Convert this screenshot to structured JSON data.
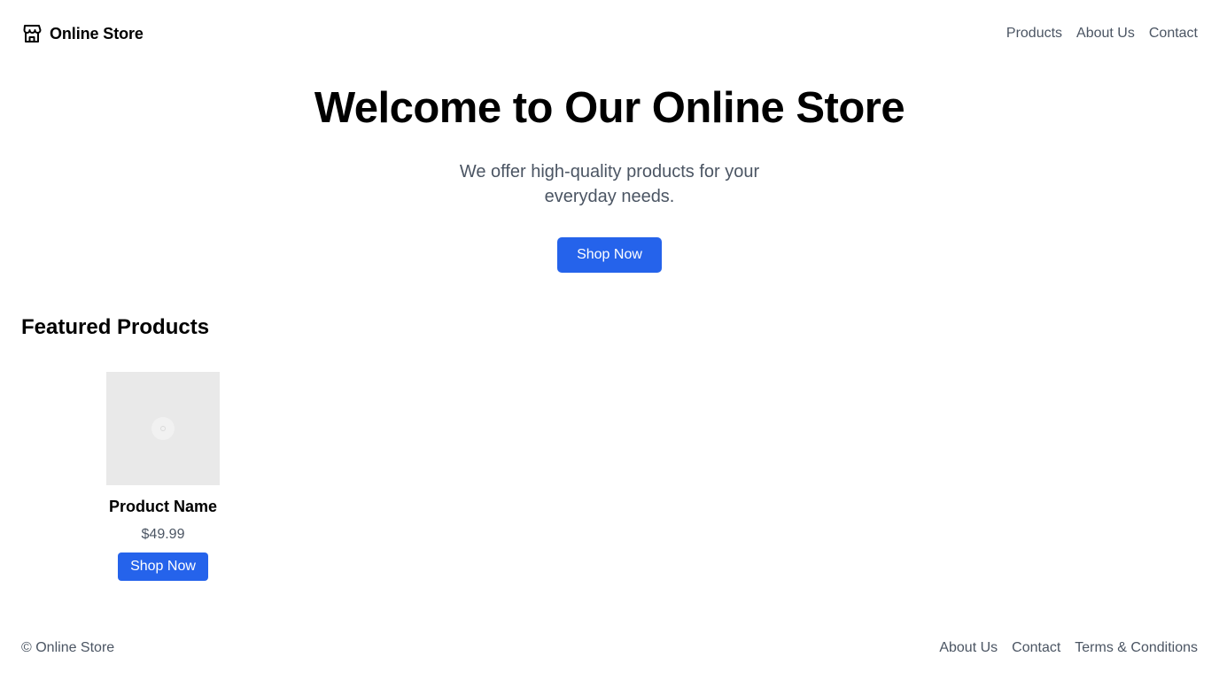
{
  "header": {
    "brand_name": "Online Store",
    "brand_icon": "store-icon",
    "nav": [
      "Products",
      "About Us",
      "Contact"
    ]
  },
  "hero": {
    "title": "Welcome to Our Online Store",
    "subtitle": "We offer high-quality products for your everyday needs.",
    "cta_label": "Shop Now"
  },
  "featured": {
    "title": "Featured Products",
    "products": [
      {
        "name": "Product Name",
        "price": "$49.99",
        "cta_label": "Shop Now",
        "image_icon": "image-placeholder-icon"
      }
    ]
  },
  "footer": {
    "copyright": "© Online Store",
    "links": [
      "About Us",
      "Contact",
      "Terms & Conditions"
    ]
  },
  "colors": {
    "primary": "#2563eb",
    "text_muted": "#4b5563",
    "image_bg": "#e9e9e9"
  }
}
